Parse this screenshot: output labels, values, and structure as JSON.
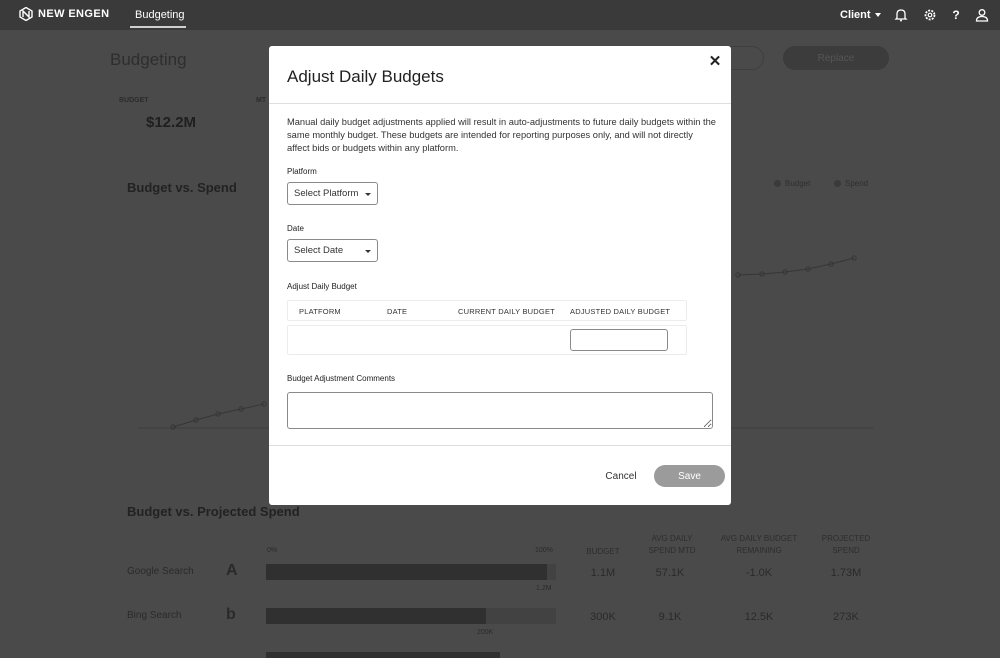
{
  "nav": {
    "brand": "NEW ENGEN",
    "active_link": "Budgeting",
    "client_label": "Client",
    "icons": [
      "bell-icon",
      "gear-icon",
      "help-icon",
      "user-icon"
    ],
    "help_glyph": "?"
  },
  "background": {
    "page_title": "Budgeting",
    "replace_button": "Replace",
    "kpi_label": "BUDGET",
    "kpi_label_2": "MT",
    "kpi_value": "$12.2M",
    "chart_title": "Budget vs. Spend",
    "legend": [
      "Budget",
      "Spend"
    ],
    "section_title": "Budget vs. Projected Spend",
    "progress_axis": [
      "0%",
      "100%"
    ],
    "columns": [
      "BUDGET",
      "AVG DAILY SPEND MTD",
      "AVG DAILY BUDGET REMAINING",
      "PROJECTED SPEND"
    ],
    "rows": [
      {
        "label": "Google Search",
        "icon": "google-ads-icon",
        "icon_glyph": "A",
        "fill": 0.97,
        "cap": "1.2M",
        "budget": "1.1M",
        "avg_spend": "57.1K",
        "avg_remaining": "-1.0K",
        "projected": "1.73M"
      },
      {
        "label": "Bing Search",
        "icon": "bing-icon",
        "icon_glyph": "b",
        "fill": 0.76,
        "cap": "200K",
        "budget": "300K",
        "avg_spend": "9.1K",
        "avg_remaining": "12.5K",
        "projected": "273K"
      }
    ]
  },
  "modal": {
    "title": "Adjust Daily Budgets",
    "description": "Manual daily budget adjustments applied will result in auto-adjustments to future daily budgets within the same monthly budget. These budgets are intended for reporting purposes only, and will not directly affect bids or budgets within any platform.",
    "platform_label": "Platform",
    "platform_select": "Select Platform",
    "date_label": "Date",
    "date_select": "Select Date",
    "adjust_label": "Adjust Daily Budget",
    "table_headers": [
      "PLATFORM",
      "DATE",
      "CURRENT DAILY BUDGET",
      "ADJUSTED DAILY BUDGET"
    ],
    "adjusted_value": "",
    "comments_label": "Budget Adjustment Comments",
    "comments_value": "",
    "cancel_label": "Cancel",
    "save_label": "Save"
  }
}
